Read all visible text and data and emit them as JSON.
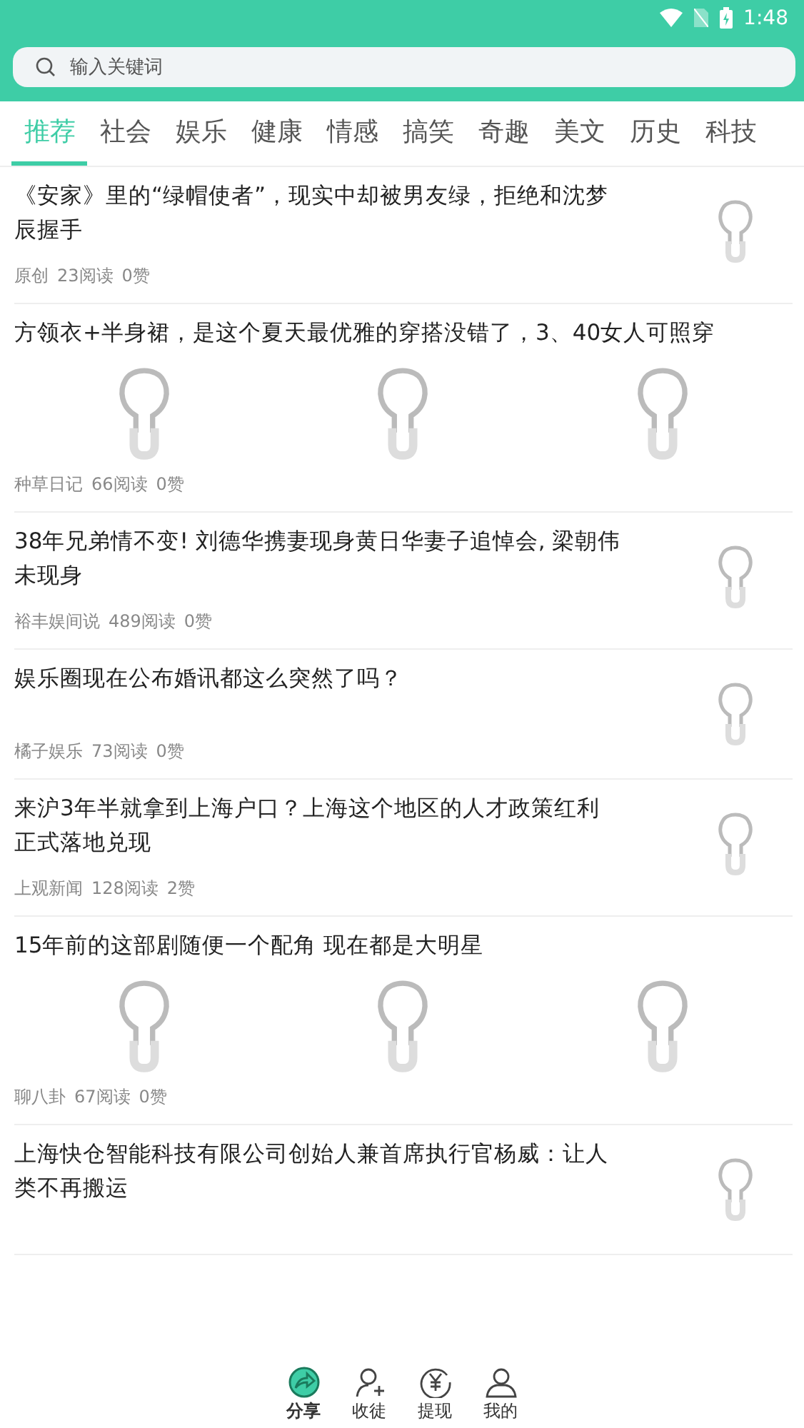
{
  "status_bar": {
    "time": "1:48"
  },
  "search": {
    "placeholder": "输入关键词"
  },
  "tabs": [
    {
      "label": "推荐",
      "selected": true
    },
    {
      "label": "社会",
      "selected": false
    },
    {
      "label": "娱乐",
      "selected": false
    },
    {
      "label": "健康",
      "selected": false
    },
    {
      "label": "情感",
      "selected": false
    },
    {
      "label": "搞笑",
      "selected": false
    },
    {
      "label": "奇趣",
      "selected": false
    },
    {
      "label": "美文",
      "selected": false
    },
    {
      "label": "历史",
      "selected": false
    },
    {
      "label": "科技",
      "selected": false
    }
  ],
  "articles": [
    {
      "kind": "single",
      "title": "《安家》里的“绿帽使者”，现实中却被男友绿，拒绝和沈梦辰握手",
      "source": "原创",
      "reads": "23阅读",
      "likes": "0赞"
    },
    {
      "kind": "triple",
      "title": "方领衣+半身裙，是这个夏天最优雅的穿搭没错了，3、40女人可照穿",
      "source": "种草日记",
      "reads": "66阅读",
      "likes": "0赞"
    },
    {
      "kind": "single",
      "title": "38年兄弟情不变! 刘德华携妻现身黄日华妻子追悼会, 梁朝伟未现身",
      "source": "裕丰娱间说",
      "reads": "489阅读",
      "likes": "0赞"
    },
    {
      "kind": "single",
      "title": "娱乐圈现在公布婚讯都这么突然了吗？",
      "source": "橘子娱乐",
      "reads": "73阅读",
      "likes": "0赞"
    },
    {
      "kind": "single",
      "title": "来沪3年半就拿到上海户口？上海这个地区的人才政策红利正式落地兑现",
      "source": "上观新闻",
      "reads": "128阅读",
      "likes": "2赞"
    },
    {
      "kind": "triple",
      "title": "15年前的这部剧随便一个配角 现在都是大明星",
      "source": "聊八卦",
      "reads": "67阅读",
      "likes": "0赞"
    },
    {
      "kind": "single",
      "title": "上海快仓智能科技有限公司创始人兼首席执行官杨威：让人类不再搬运"
    }
  ],
  "bottom_nav": [
    {
      "label": "分享",
      "kind": "share",
      "selected": true
    },
    {
      "label": "收徒",
      "kind": "recruit",
      "selected": false
    },
    {
      "label": "提现",
      "kind": "withdraw",
      "selected": false
    },
    {
      "label": "我的",
      "kind": "profile",
      "selected": false
    }
  ]
}
